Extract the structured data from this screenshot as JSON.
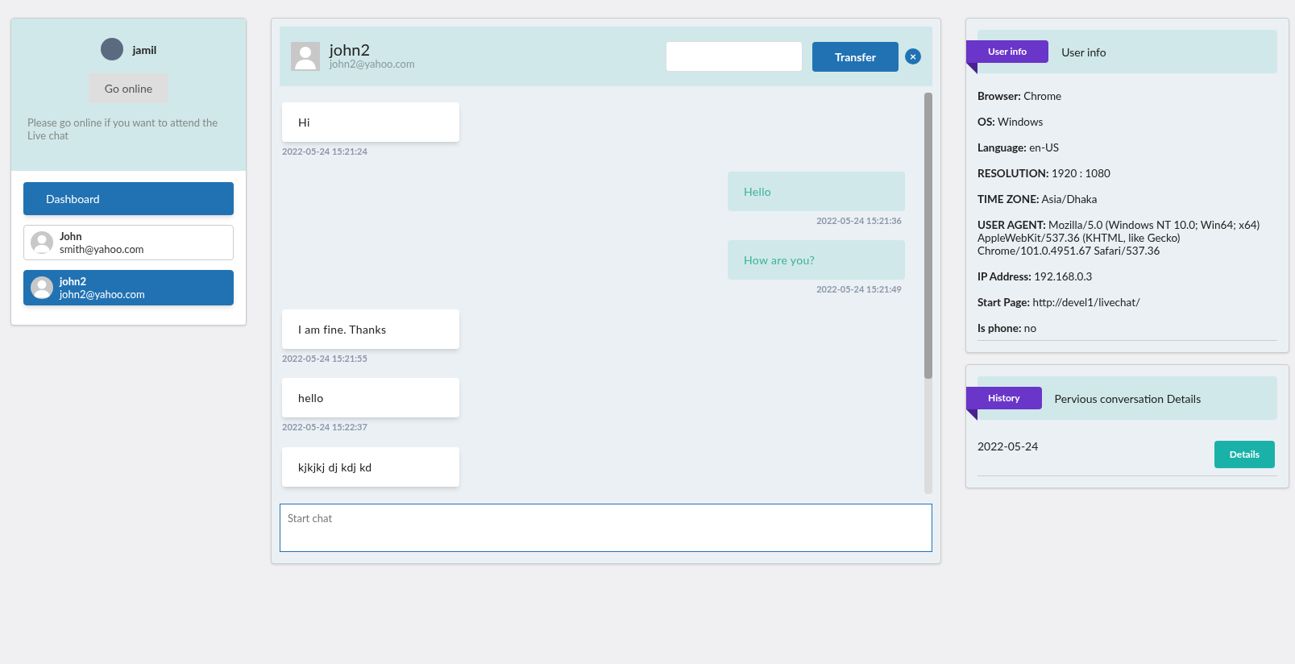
{
  "agent": {
    "name": "jamil",
    "button": "Go online",
    "notice": "Please go online if you want to attend the Live chat"
  },
  "sidebar": {
    "dashboard": "Dashboard",
    "visitors": [
      {
        "name": "John",
        "email": "smith@yahoo.com",
        "selected": false
      },
      {
        "name": "john2",
        "email": "john2@yahoo.com",
        "selected": true
      }
    ]
  },
  "chat": {
    "name": "john2",
    "email": "john2@yahoo.com",
    "transfer_button": "Transfer",
    "close_icon": "×",
    "messages": [
      {
        "kind": "in",
        "text": "Hi",
        "time": "2022-05-24 15:21:24"
      },
      {
        "kind": "out",
        "text": "Hello",
        "time": "2022-05-24 15:21:36"
      },
      {
        "kind": "out",
        "text": "How are you?",
        "time": "2022-05-24 15:21:49"
      },
      {
        "kind": "in",
        "text": "I am fine. Thanks",
        "time": "2022-05-24 15:21:55"
      },
      {
        "kind": "in",
        "text": "hello",
        "time": "2022-05-24 15:22:37"
      },
      {
        "kind": "in",
        "text": "kjkjkj dj kdj kd"
      }
    ],
    "input_placeholder": "Start chat"
  },
  "user_info": {
    "tag": "User info",
    "title": "User info",
    "fields": [
      {
        "label": "Browser:",
        "value": "Chrome"
      },
      {
        "label": "OS:",
        "value": "Windows"
      },
      {
        "label": "Language:",
        "value": "en-US"
      },
      {
        "label": "RESOLUTION:",
        "value": "1920 : 1080"
      },
      {
        "label": "TIME ZONE:",
        "value": "Asia/Dhaka"
      },
      {
        "label": "USER AGENT:",
        "value": "Mozilla/5.0 (Windows NT 10.0; Win64; x64) AppleWebKit/537.36 (KHTML, like Gecko) Chrome/101.0.4951.67 Safari/537.36"
      },
      {
        "label": "IP Address:",
        "value": "192.168.0.3"
      },
      {
        "label": "Start Page:",
        "value": "http://devel1/livechat/"
      },
      {
        "label": "Is phone:",
        "value": "no"
      }
    ]
  },
  "history": {
    "tag": "History",
    "title": "Pervious conversation Details",
    "items": [
      {
        "date": "2022-05-24",
        "button": "Details"
      }
    ]
  }
}
